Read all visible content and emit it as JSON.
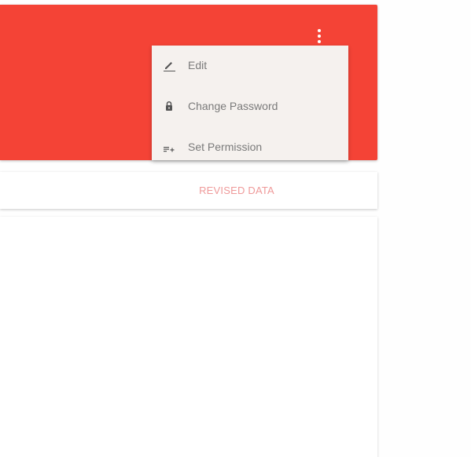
{
  "header": {
    "more_icon": "more-vert-icon",
    "accent_color": "#f44336"
  },
  "menu": {
    "items": [
      {
        "label": "Edit",
        "icon": "pencil-icon"
      },
      {
        "label": "Change Password",
        "icon": "lock-icon"
      },
      {
        "label": "Set Permission",
        "icon": "playlist-add-icon"
      }
    ]
  },
  "tabs": {
    "revised_label": "REVISED DATA"
  }
}
